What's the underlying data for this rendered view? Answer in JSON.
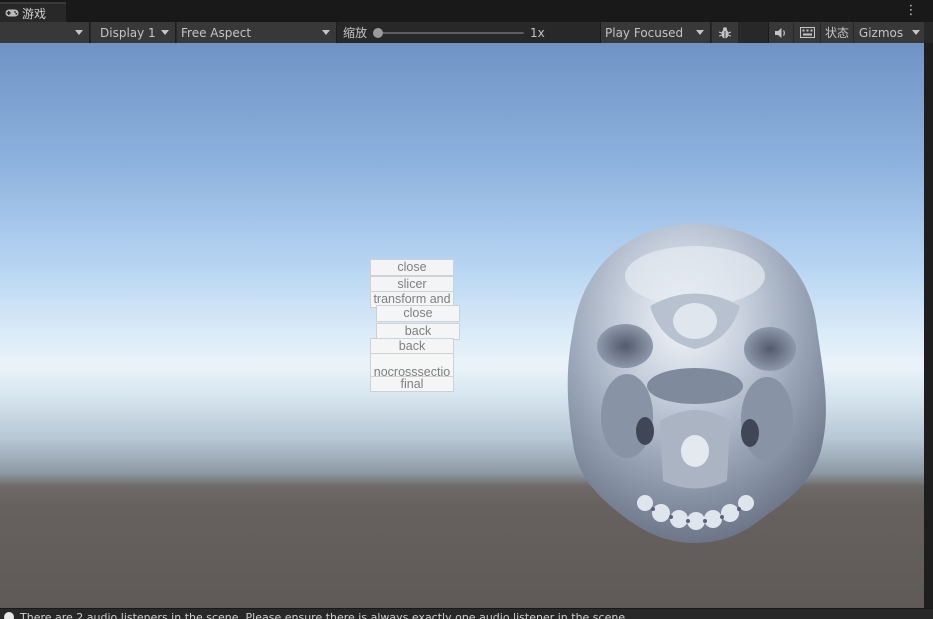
{
  "tab": {
    "title": "游戏",
    "menu_glyph": "⋮"
  },
  "toolbar": {
    "display": "Display 1",
    "aspect": "Free Aspect",
    "scale_label": "缩放",
    "scale_value": 0.0,
    "scale_text": "1x",
    "play_mode": "Play Focused",
    "stats_label": "状态",
    "gizmos_label": "Gizmos"
  },
  "scene_buttons": [
    {
      "label": "close"
    },
    {
      "label": "slicer"
    },
    {
      "label": "transform and"
    },
    {
      "label": "close"
    },
    {
      "label": "back"
    },
    {
      "label": "back"
    },
    {
      "label": "nocrosssectio\nn"
    },
    {
      "label": "final"
    }
  ],
  "status": {
    "message": "There are 2 audio listeners in the scene. Please ensure there is always exactly one audio listener in the scene."
  },
  "colors": {
    "editor_bg": "#191919",
    "toolbar_bg": "#282828",
    "sky_top": "#6f93c4",
    "horizon": "#eaf3f9",
    "ground": "#5f5a58"
  }
}
